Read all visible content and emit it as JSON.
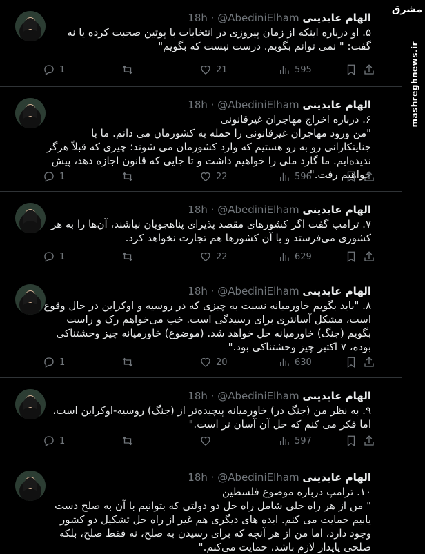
{
  "author": {
    "name": "الهام عابدینی",
    "handle": "@AbediniElham",
    "dot": "·"
  },
  "watermark": {
    "logo": "مشرق",
    "url": "mashreghnews.ir"
  },
  "colors": {
    "background": "#000000",
    "text": "#e7e9ea",
    "muted": "#71767b",
    "divider": "#2f3336"
  },
  "tweets": [
    {
      "time": "18h",
      "text": "۵. او درباره اینکه از زمان پیروزی در انتخابات با پوتین صحبت کرده یا نه گفت: \" نمی توانم بگویم. درست نیست که بگویم\"",
      "replies": "1",
      "retweets": "",
      "likes": "21",
      "views": "595"
    },
    {
      "time": "18h",
      "text": "۶. درباره اخراج مهاجران غیرقانونی\n\"من ورود مهاجران غیرقانونی را حمله به کشورمان می دانم. ما با جنایتکارانی رو به رو هستیم که وارد کشورمان می شوند؛ چیزی که قبلاً هرگز ندیده‌ایم. ما گارد ملی را خواهیم داشت و تا جایی که قانون اجازه دهد، پیش خواهیم رفت.\"",
      "replies": "1",
      "retweets": "",
      "likes": "22",
      "views": "596"
    },
    {
      "time": "18h",
      "text": "۷. ترامپ گفت اگر کشورهای مقصد پذیرای پناهجویان نباشند، آن‌ها را به هر کشوری می‌فرستد و با آن کشورها هم تجارت نخواهد کرد.",
      "replies": "1",
      "retweets": "",
      "likes": "22",
      "views": "629"
    },
    {
      "time": "18h",
      "text": "۸. \"باید بگویم خاورمیانه نسبت به چیزی که در روسیه و اوکراین در حال وقوع است، مشکل آسانتری برای رسیدگی است. خب می‌خواهم رک و راست بگویم (جنگ) خاورمیانه حل خواهد شد. (موضوع) خاورمیانه چیز وحشتناکی بوده، ۷ اکتبر چیز وحشتناکی بود.\"",
      "replies": "1",
      "retweets": "",
      "likes": "20",
      "views": "630"
    },
    {
      "time": "18h",
      "text": "۹. به نظر من (جنگ در) خاورمیانه پیچیده‌تر از (جنگ) روسیه-اوکراین است، اما فکر می کنم که حل آن آسان تر است.\"",
      "replies": "1",
      "retweets": "",
      "likes": "",
      "views": "597"
    },
    {
      "time": "18h",
      "text": "۱۰. ترامپ درباره موضوع فلسطین\n\" من از هر راه حلی شامل راه حل دو دولتی که بتوانیم با آن به صلح دست یابیم حمایت می کنم. ایده های دیگری هم غیر از راه حل تشکیل دو کشور وجود دارد، اما من از هر آنچه که برای رسیدن به صلح، نه فقط صلح، بلکه صلحی پایدار لازم باشد، حمایت می‌کنم.\"",
      "replies": "",
      "retweets": "",
      "likes": "",
      "views": ""
    }
  ]
}
